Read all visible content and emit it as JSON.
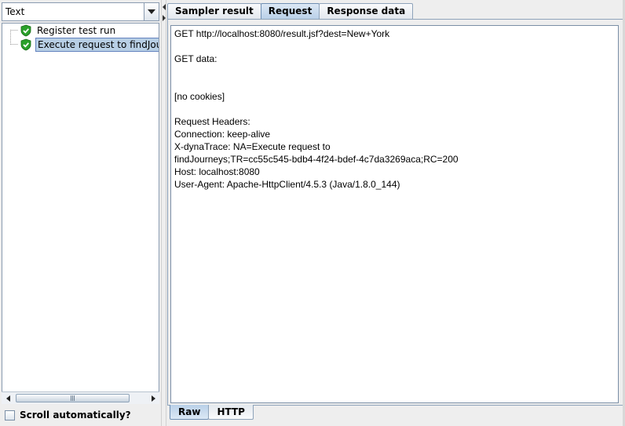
{
  "left_panel": {
    "renderer_select": {
      "value": "Text"
    },
    "tree": {
      "items": [
        {
          "label": "Register test run",
          "status": "success",
          "selected": false
        },
        {
          "label": "Execute request to findJourneys",
          "status": "success",
          "selected": true
        }
      ]
    },
    "scroll_auto": {
      "label": "Scroll automatically?",
      "checked": false
    }
  },
  "right_panel": {
    "tabs": [
      {
        "label": "Sampler result",
        "active": false
      },
      {
        "label": "Request",
        "active": true
      },
      {
        "label": "Response data",
        "active": false
      }
    ],
    "request_text": [
      "GET http://localhost:8080/result.jsf?dest=New+York",
      "",
      "GET data:",
      "",
      "",
      "[no cookies]",
      "",
      "Request Headers:",
      "Connection: keep-alive",
      "X-dynaTrace: NA=Execute request to",
      "findJourneys;TR=cc55c545-bdb4-4f24-bdef-4c7da3269aca;RC=200",
      "Host: localhost:8080",
      "User-Agent: Apache-HttpClient/4.5.3 (Java/1.8.0_144)"
    ],
    "bottom_tabs": [
      {
        "label": "Raw",
        "active": true
      },
      {
        "label": "HTTP",
        "active": false
      }
    ]
  },
  "colors": {
    "background": "#eeeeee",
    "selection": "#b8cfe5",
    "active_tab": "#b9d0e8",
    "success_icon": "#2aa02a"
  }
}
